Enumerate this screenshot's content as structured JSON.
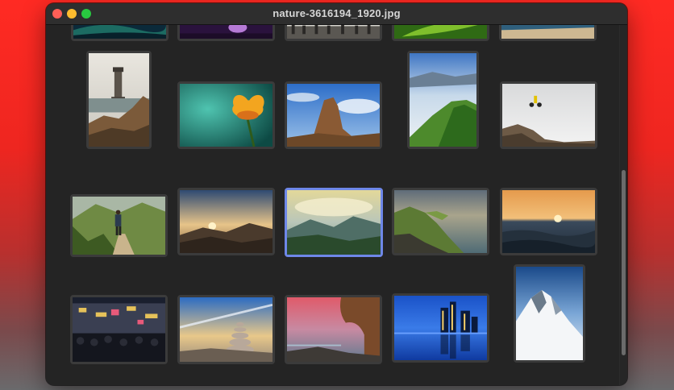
{
  "window": {
    "title": "nature-3616194_1920.jpg"
  },
  "gallery": {
    "selected_photo": "mountain-valley-photo",
    "photos": [
      "aurora-photo",
      "purple-flower-photo",
      "street-crowd-photo",
      "green-leaf-photo",
      "beach-photo",
      "lighthouse-photo",
      "orange-flower-photo",
      "rock-spire-photo",
      "green-ridge-photo",
      "mountain-biker-photo",
      "hiker-trail-photo",
      "sunset-mountains-photo",
      "mountain-valley-photo",
      "sea-cliffs-photo",
      "ocean-sunset-photo",
      "city-night-crowd-photo",
      "stone-cairn-photo",
      "coastal-arch-photo",
      "city-skyline-night-photo",
      "snowy-peak-photo"
    ]
  },
  "colors": {
    "selection": "#6e87e8",
    "window_bg": "#242424",
    "desktop_top": "#ff2a23"
  }
}
